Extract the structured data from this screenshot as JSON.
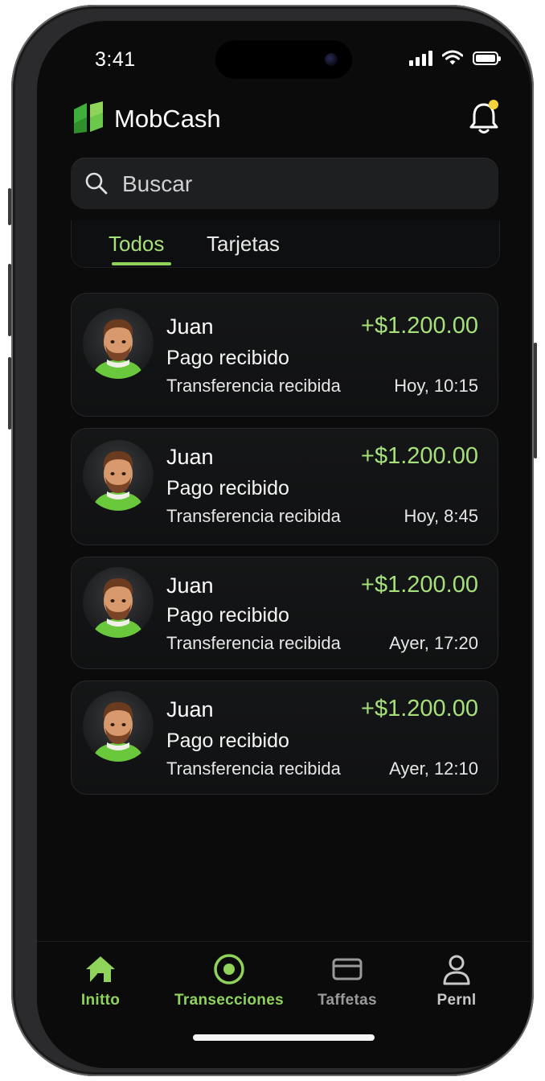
{
  "status_bar": {
    "time": "3:41"
  },
  "app": {
    "name": "MobCash"
  },
  "search": {
    "placeholder": "Buscar"
  },
  "tabs": [
    {
      "label": "Todos",
      "active": true
    },
    {
      "label": "Tarjetas",
      "active": false
    }
  ],
  "transactions": [
    {
      "name": "Juan",
      "title": "Pago recibido",
      "subtitle": "Transferencia recibida",
      "amount": "+$1.200.00",
      "time": "Hoy, 10:15",
      "avatar_icon": "person-avatar-icon"
    },
    {
      "name": "Juan",
      "title": "Pago recibido",
      "subtitle": "Transferencia recibida",
      "amount": "+$1.200.00",
      "time": "Hoy, 8:45",
      "avatar_icon": "person-avatar-icon"
    },
    {
      "name": "Juan",
      "title": "Pago recibido",
      "subtitle": "Transferencia recibida",
      "amount": "+$1.200.00",
      "time": "Ayer, 17:20",
      "avatar_icon": "person-avatar-icon"
    },
    {
      "name": "Juan",
      "title": "Pago recibido",
      "subtitle": "Transferencia recibida",
      "amount": "+$1.200.00",
      "time": "Ayer, 12:10",
      "avatar_icon": "person-avatar-icon"
    }
  ],
  "nav": [
    {
      "label": "Initto",
      "icon": "home-icon",
      "color": "#8fd35b"
    },
    {
      "label": "Transecciones",
      "icon": "target-icon",
      "color": "#8fd35b"
    },
    {
      "label": "Taffetas",
      "icon": "card-icon",
      "color": "#9a9a9a"
    },
    {
      "label": "Pernl",
      "icon": "profile-icon",
      "color": "#c8c8c8"
    }
  ],
  "colors": {
    "accent": "#a6e07a",
    "background": "#0b0b0c",
    "card": "#151617",
    "notification_dot": "#f2d43a"
  }
}
